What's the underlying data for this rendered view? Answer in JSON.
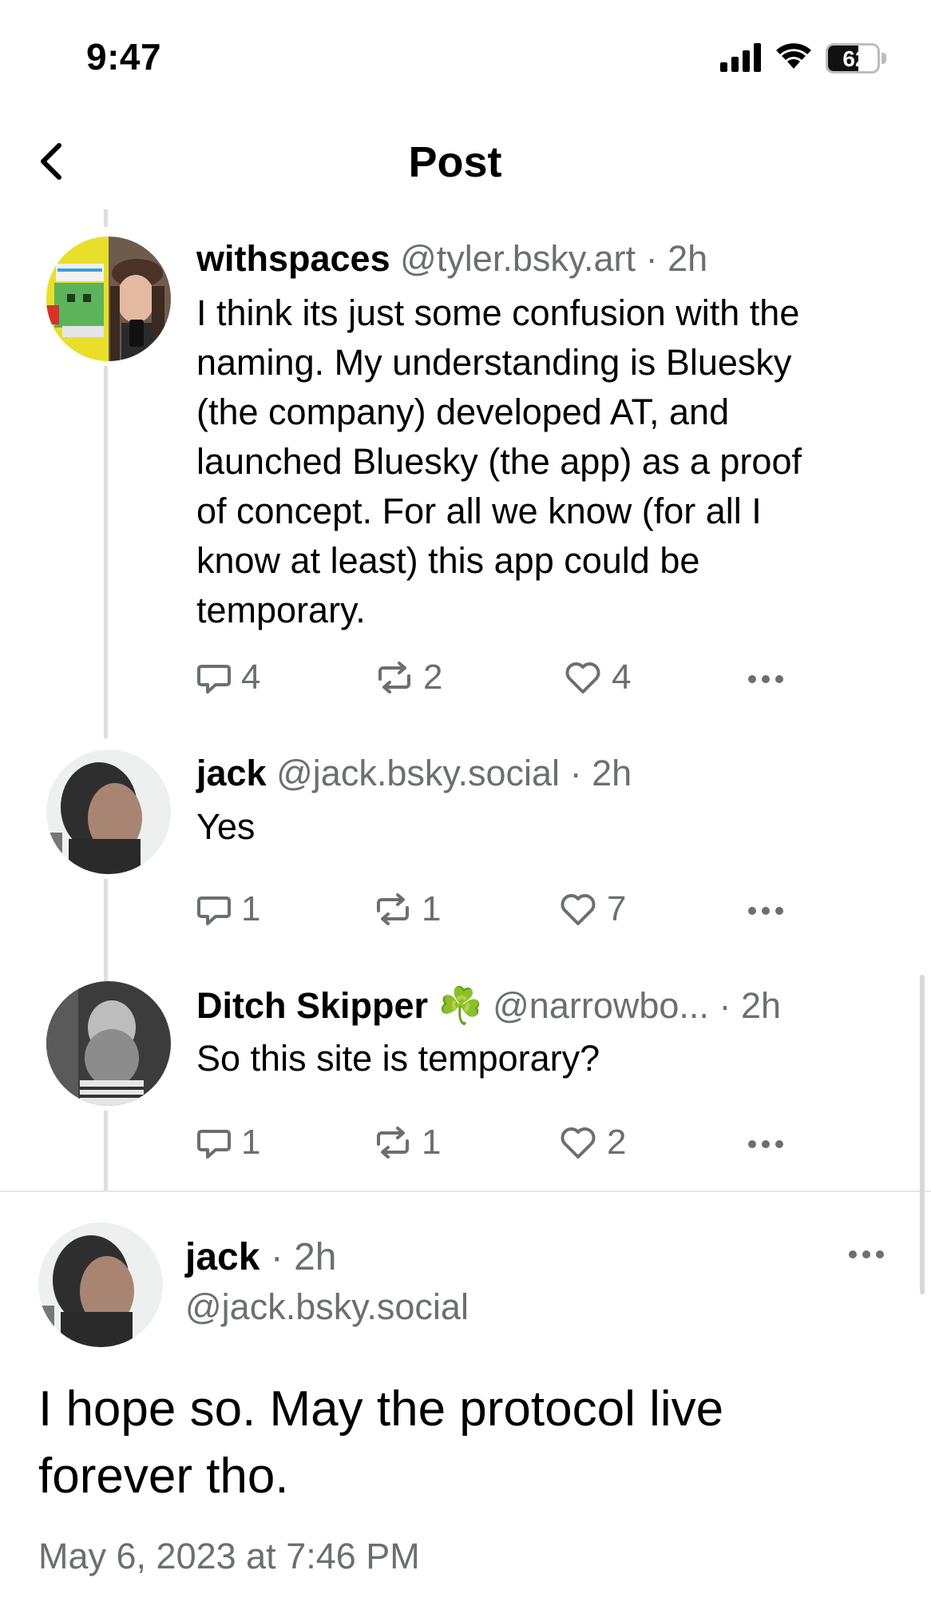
{
  "status_bar": {
    "time": "9:47",
    "battery_percent": "62",
    "battery_level": 0.62
  },
  "header": {
    "title": "Post",
    "back_icon": "chevron-left-icon"
  },
  "thread": [
    {
      "display_name": "withspaces",
      "handle": "@tyler.bsky.art",
      "time": "2h",
      "text_lines": [
        "I think its just some confusion with the",
        "naming. My understanding is Bluesky",
        "(the company) developed AT, and",
        "launched Bluesky (the app) as a proof",
        "of concept. For all we know (for all I",
        "know at least) this app could be",
        "temporary."
      ],
      "replies": "4",
      "reposts": "2",
      "likes": "4"
    },
    {
      "display_name": "jack",
      "handle": "@jack.bsky.social",
      "time": "2h",
      "text_lines": [
        "Yes"
      ],
      "replies": "1",
      "reposts": "1",
      "likes": "7"
    },
    {
      "display_name": "Ditch Skipper",
      "name_emoji": "☘️",
      "handle": "@narrowbo...",
      "time": "2h",
      "text_lines": [
        "So this site is temporary?"
      ],
      "replies": "1",
      "reposts": "1",
      "likes": "2"
    }
  ],
  "main_post": {
    "display_name": "jack",
    "time": "2h",
    "handle": "@jack.bsky.social",
    "text_lines": [
      "I hope so. May the protocol live",
      "forever tho."
    ],
    "date": "May 6, 2023 at 7:46 PM"
  },
  "separator": "·",
  "colors": {
    "text_primary": "#000000",
    "text_secondary": "#6b6e72",
    "thread_line": "#dedede",
    "divider": "#e6e6e6",
    "background": "#ffffff"
  }
}
